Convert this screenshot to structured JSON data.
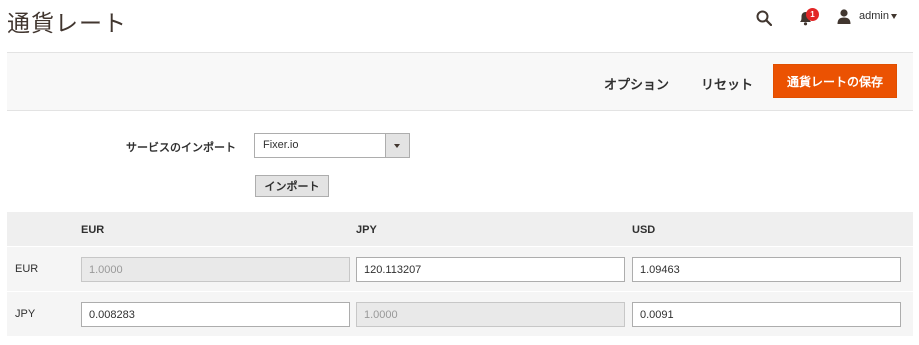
{
  "header": {
    "title": "通貨レート",
    "notifications_count": "1",
    "user_name": "admin",
    "icons": [
      "search-icon",
      "bell-icon",
      "user-icon",
      "caret-down-icon"
    ]
  },
  "actions": {
    "options_label": "オプション",
    "reset_label": "リセット",
    "save_label": "通貨レートの保存",
    "save_color": "#eb5202"
  },
  "import": {
    "label": "サービスのインポート",
    "selected_service": "Fixer.io",
    "button_label": "インポート"
  },
  "rates": {
    "columns": [
      "EUR",
      "JPY",
      "USD"
    ],
    "rows": [
      {
        "currency": "EUR",
        "values": [
          "1.0000",
          "120.113207",
          "1.09463"
        ],
        "disabled_index": 0
      },
      {
        "currency": "JPY",
        "values": [
          "0.008283",
          "1.0000",
          "0.0091"
        ],
        "disabled_index": 1
      }
    ]
  }
}
